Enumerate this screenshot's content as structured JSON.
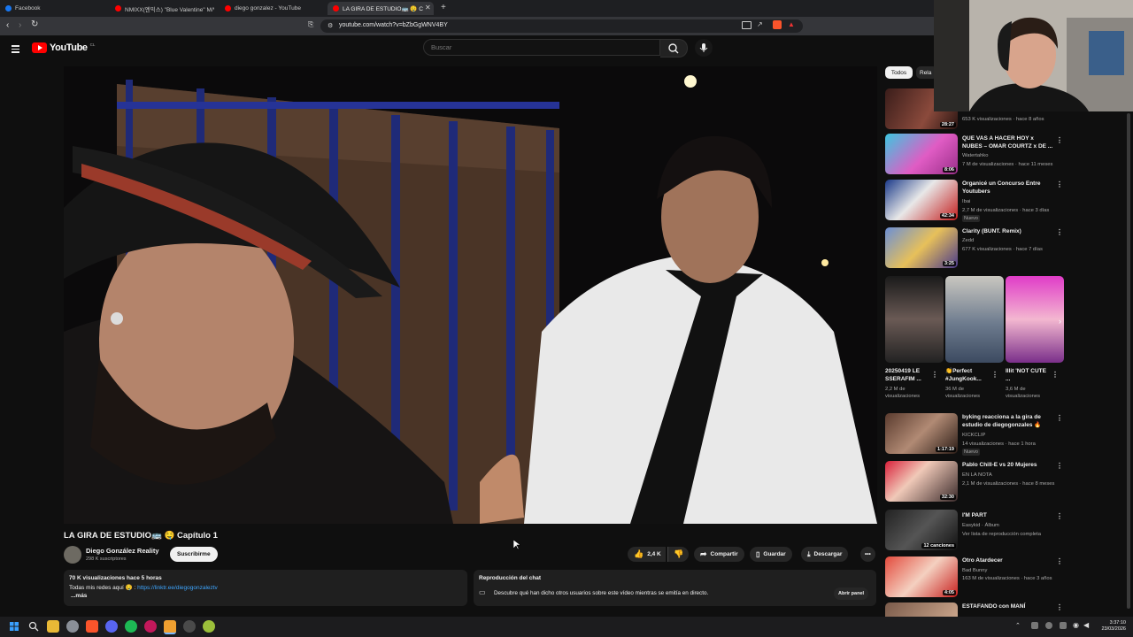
{
  "browser": {
    "tabs": [
      {
        "title": "Facebook",
        "color": "#1877f2"
      },
      {
        "title": "NMIXX(엔믹스) \"Blue Valentine\" M/V",
        "color": "#ff0000"
      },
      {
        "title": "diego gonzalez - YouTube",
        "color": "#ff0000"
      },
      {
        "title": "LA GIRA DE ESTUDIO🚌 🤤 C",
        "color": "#ff0000",
        "active": true
      }
    ],
    "new_tab_icon": "plus-icon",
    "url": "youtube.com/watch?v=bZbGgWNV4BY"
  },
  "youtube": {
    "logo_text": "YouTube",
    "country_code": "CL",
    "search_placeholder": "Buscar"
  },
  "video": {
    "title": "LA GIRA DE ESTUDIO🚌 🤤 Capítulo 1",
    "channel_name": "Diego González Reality",
    "subscribers": "298 K suscriptores",
    "subscribe_label": "Suscribirme",
    "likes": "2,4 K",
    "share_label": "Compartir",
    "save_label": "Guardar",
    "download_label": "Descargar"
  },
  "description": {
    "stats": "70 K visualizaciones  hace 5 horas",
    "line1_prefix": "Todas mis redes aquí 🤤 : ",
    "link": "https://linktr.ee/diegogonzaleztv",
    "more": "...más"
  },
  "chat_replay": {
    "heading": "Reproducción del chat",
    "text": "Descubre qué han dicho otros usuarios sobre este vídeo mientras se emitía en directo.",
    "open_label": "Abrir panel"
  },
  "sidebar": {
    "chips": [
      {
        "label": "Todos",
        "active": true
      },
      {
        "label": "Rela",
        "active": false
      }
    ],
    "videos": [
      {
        "title": "",
        "channel": "",
        "meta": "653 K visualizaciones · hace 8 años",
        "duration": "28:27",
        "extra": ""
      },
      {
        "title": "QUE VAS A HACER HOY x NUBES – OMAR COURTZ x DE ...",
        "channel": "Watertahko",
        "meta": "7 M de visualizaciones · hace 11 meses",
        "duration": "8:06",
        "extra": ""
      },
      {
        "title": "Organicé un Concurso Entre Youtubers",
        "channel": "Ibai",
        "meta": "2,7 M de visualizaciones · hace 3 días",
        "duration": "42:34",
        "extra": "Nuevo"
      },
      {
        "title": "Clarity (BUNT. Remix)",
        "channel": "Zedd",
        "meta": "677 K visualizaciones · hace 7 días",
        "duration": "3:25",
        "extra": ""
      }
    ],
    "shorts": [
      {
        "title": "20250419 LE SSERAFIM ...",
        "views": "2,2 M de visualizaciones"
      },
      {
        "title": "👏Perfect #JungKook...",
        "views": "36 M de visualizaciones"
      },
      {
        "title": "Illit 'NOT CUTE ...",
        "views": "3,6 M de visualizaciones"
      }
    ],
    "videos2": [
      {
        "title": "byking reacciona a la gira de estudio de diegogonzales 🔥",
        "channel": "KICKCLIP",
        "meta": "14 visualizaciones · hace 1 hora",
        "duration": "1:17:19",
        "extra": "Nuevo"
      },
      {
        "title": "Pablo Chill-E vs 20 Mujeres",
        "channel": "EN LA NOTA",
        "meta": "2,1 M de visualizaciones · hace 8 meses",
        "duration": "32:30",
        "extra": ""
      },
      {
        "title": "I'M PART",
        "channel": "Easykid · Álbum",
        "meta": "Ver lista de reproducción completa",
        "duration": "12 canciones",
        "extra": ""
      },
      {
        "title": "Otro Atardecer",
        "channel": "Bad Bunny",
        "meta": "163 M de visualizaciones · hace 3 años",
        "duration": "4:05",
        "extra": ""
      },
      {
        "title": "ESTAFANDO con MANÍ",
        "channel": "",
        "meta": "",
        "duration": "",
        "extra": ""
      }
    ]
  },
  "taskbar": {
    "time": "3:37:10",
    "date": "23/03/2026"
  }
}
